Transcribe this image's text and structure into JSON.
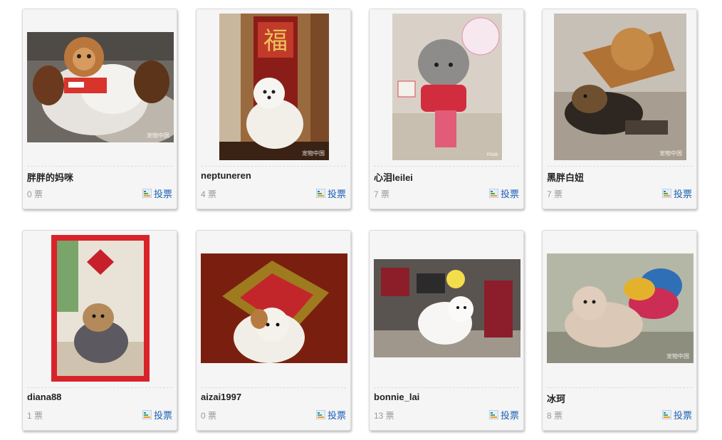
{
  "vote_label": "投票",
  "colors": {
    "card_bg": "#f5f5f5",
    "name_text": "#222222",
    "count_text": "#999999",
    "vote_link": "#1a5fb4"
  },
  "cards": [
    {
      "name": "胖胖的妈咪",
      "votes": "0 票",
      "photo": "toy-dog-portrait",
      "watermark": "宠物中国"
    },
    {
      "name": "neptuneren",
      "votes": "4 票",
      "photo": "bichon-fu-scroll",
      "watermark": "宠物中国"
    },
    {
      "name": "心泪leilei",
      "votes": "7 票",
      "photo": "gray-poodle-red-envelope",
      "watermark": "mua"
    },
    {
      "name": "黑胖白妞",
      "votes": "7 票",
      "photo": "yorkie-fu-sign",
      "watermark": "宠物中国"
    },
    {
      "name": "diana88",
      "votes": "1 票",
      "photo": "yorkie-red-frame",
      "watermark": ""
    },
    {
      "name": "aizai1997",
      "votes": "0 票",
      "photo": "dog-red-pillow",
      "watermark": ""
    },
    {
      "name": "bonnie_lai",
      "votes": "13 票",
      "photo": "samoyed-living-room",
      "watermark": ""
    },
    {
      "name": "冰珂",
      "votes": "8 票",
      "photo": "terrier-sofa",
      "watermark": "宠物中国"
    }
  ]
}
